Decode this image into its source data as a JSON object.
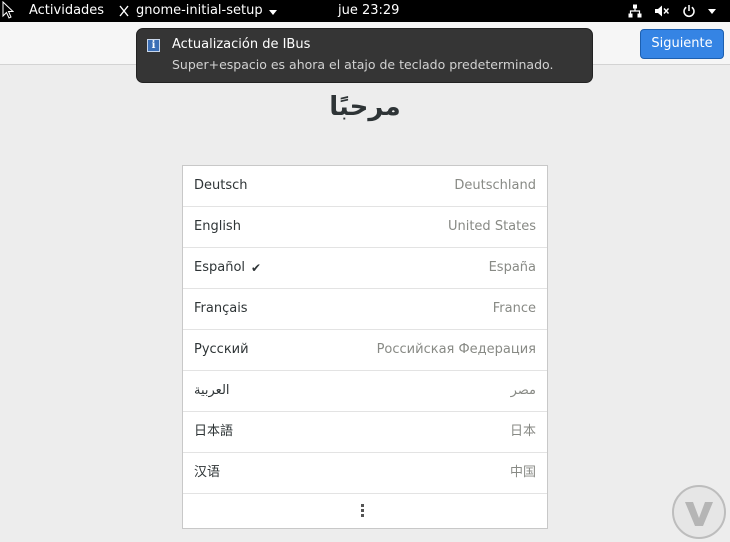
{
  "topbar": {
    "activities": "Actividades",
    "app_name": "gnome-initial-setup",
    "clock": "jue 23:29"
  },
  "header": {
    "next_label": "Siguiente"
  },
  "notification": {
    "title": "Actualización de IBus",
    "body": "Super+espacio es ahora el atajo de teclado predeterminado."
  },
  "welcome": "مرحبًا",
  "languages": [
    {
      "name": "Deutsch",
      "region": "Deutschland",
      "selected": false
    },
    {
      "name": "English",
      "region": "United States",
      "selected": false
    },
    {
      "name": "Español",
      "region": "España",
      "selected": true
    },
    {
      "name": "Français",
      "region": "France",
      "selected": false
    },
    {
      "name": "Русский",
      "region": "Российская Федерация",
      "selected": false
    },
    {
      "name": "العربية",
      "region": "مصر",
      "selected": false
    },
    {
      "name": "日本語",
      "region": "日本",
      "selected": false
    },
    {
      "name": "汉语",
      "region": "中国",
      "selected": false
    }
  ],
  "check_mark": "✔",
  "colors": {
    "accent": "#3584e4",
    "topbar": "#000000",
    "notification_bg": "#353535"
  }
}
